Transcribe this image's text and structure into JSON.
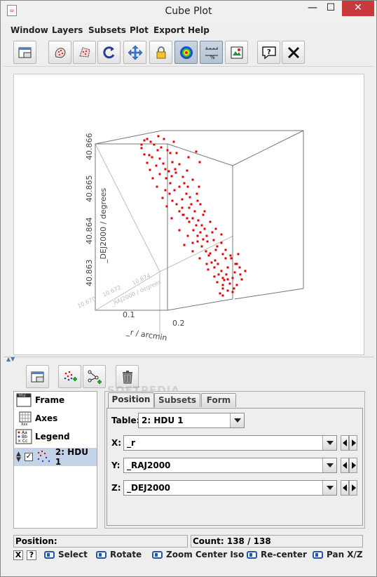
{
  "window": {
    "title": "Cube Plot",
    "minimize": "—",
    "maximize": "☐",
    "close": "✕"
  },
  "menu": [
    "Window",
    "Layers",
    "Subsets",
    "Plot",
    "Export",
    "Help"
  ],
  "toolbar_icons": [
    "new-window-icon",
    "draw-subset-region-icon",
    "draw-subset-polygon-icon",
    "rotate-reset-icon",
    "navigation-icon",
    "lock-aspect-icon",
    "density-icon",
    "axis-scale-icon",
    "export-image-icon",
    "help-icon",
    "close-window-icon"
  ],
  "plot": {
    "type": "scatter3d",
    "axes": {
      "x": {
        "label": "_r / arcmin",
        "ticks": [
          "0.1",
          "0.2"
        ]
      },
      "y": {
        "label": "_RAJ2000 / degrees",
        "ticks": [
          "10.670",
          "10.672",
          "10.674"
        ]
      },
      "z": {
        "label": "_DEJ2000 / degrees",
        "ticks": [
          "40.863",
          "40.864",
          "40.865",
          "40.866"
        ]
      }
    },
    "marker_color": "#e00000"
  },
  "lower_toolbar_icons": [
    "new-window-icon",
    "add-position-layer-icon",
    "add-pair-layer-icon",
    "delete-layer-icon"
  ],
  "layers": [
    {
      "label": "Frame",
      "icon": "frame-icon"
    },
    {
      "label": "Axes",
      "icon": "axes-icon"
    },
    {
      "label": "Legend",
      "icon": "legend-icon"
    },
    {
      "label": "2: HDU 1",
      "icon": "points-icon",
      "checked": true
    }
  ],
  "tabs": [
    "Position",
    "Subsets",
    "Form"
  ],
  "form": {
    "table_label": "Table:",
    "table_value": "2: HDU 1",
    "x_label": "X:",
    "x_value": "_r",
    "y_label": "Y:",
    "y_value": "_RAJ2000",
    "z_label": "Z:",
    "z_value": "_DEJ2000"
  },
  "status": {
    "position": "Position:",
    "count": "Count: 138 / 138"
  },
  "bottom": {
    "close_small": "X",
    "help_small": "?",
    "actions": [
      "Select",
      "Rotate",
      "Zoom Center Iso",
      "Re-center",
      "Pan X/Z"
    ]
  },
  "watermark": "SOFTPEDIA"
}
